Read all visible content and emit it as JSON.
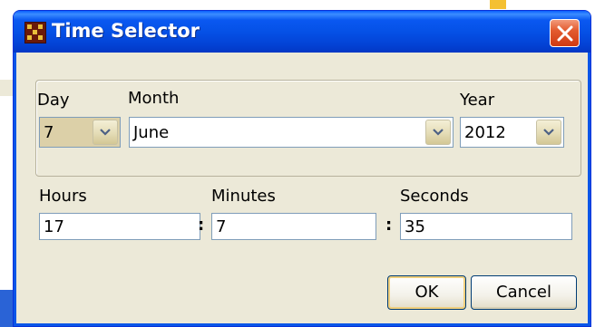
{
  "window": {
    "title": "Time Selector"
  },
  "date": {
    "day_label": "Day",
    "day_value": "7",
    "month_label": "Month",
    "month_value": "June",
    "year_label": "Year",
    "year_value": "2012"
  },
  "time": {
    "hours_label": "Hours",
    "hours_value": "17",
    "minutes_label": "Minutes",
    "minutes_value": "7",
    "seconds_label": "Seconds",
    "seconds_value": "35",
    "separator": ":"
  },
  "buttons": {
    "ok_label": "OK",
    "cancel_label": "Cancel"
  },
  "icons": {
    "app": "app-icon",
    "close": "close-icon",
    "dropdown": "chevron-down-icon"
  },
  "colors": {
    "titlebar": "#0551e6",
    "dialog_bg": "#ece9d8",
    "close_button": "#e35b2f",
    "input_border": "#7f9db9"
  }
}
